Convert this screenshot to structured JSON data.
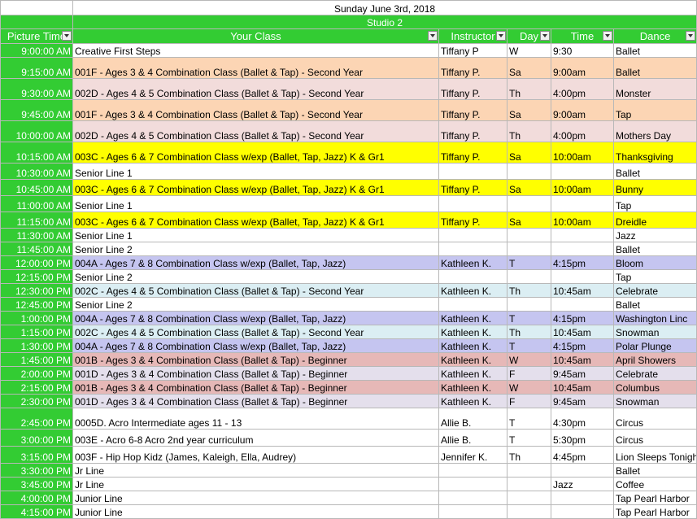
{
  "sheet": {
    "title": "Sunday June 3rd, 2018",
    "studio": "Studio 2",
    "columns": [
      "Picture Time",
      "Your Class",
      "Instructor",
      "Day",
      "Time",
      "Dance"
    ],
    "colors": {
      "header_green": "#33cc33",
      "peach": "#fcd5b4",
      "pink": "#f2dcdb",
      "yellow": "#ffff00",
      "lavender": "#c5c5f0",
      "light_blue": "#dbeef3",
      "rose": "#e6b8b7",
      "light_lavender": "#e4dfec"
    },
    "rows": [
      {
        "time": "9:00:00 AM",
        "class": "Creative First Steps",
        "instructor": "Tiffany P",
        "day": "W",
        "ctime": "9:30",
        "dance": "Ballet",
        "bg": "#ffffff",
        "bold": true,
        "h": 17
      },
      {
        "time": "9:15:00 AM",
        "class": "001F - Ages 3 & 4 Combination Class (Ballet & Tap) - Second Year",
        "instructor": "Tiffany P.",
        "day": "Sa",
        "ctime": "9:00am",
        "dance": "Ballet",
        "bg": "#fcd5b4",
        "bold": false,
        "h": 26
      },
      {
        "time": "9:30:00 AM",
        "class": "002D - Ages 4 & 5 Combination Class (Ballet & Tap) - Second Year",
        "instructor": "Tiffany P.",
        "day": "Th",
        "ctime": "4:00pm",
        "dance": "Monster",
        "bg": "#f2dcdb",
        "bold": false,
        "h": 26
      },
      {
        "time": "9:45:00 AM",
        "class": "001F - Ages 3 & 4 Combination Class (Ballet & Tap) - Second Year",
        "instructor": "Tiffany P.",
        "day": "Sa",
        "ctime": "9:00am",
        "dance": "Tap",
        "bg": "#fcd5b4",
        "bold": false,
        "h": 26
      },
      {
        "time": "10:00:00 AM",
        "class": "002D - Ages 4 & 5 Combination Class (Ballet & Tap) - Second Year",
        "instructor": "Tiffany P.",
        "day": "Th",
        "ctime": "4:00pm",
        "dance": "Mothers Day",
        "bg": "#f2dcdb",
        "bold": false,
        "h": 26
      },
      {
        "time": "10:15:00 AM",
        "class": "003C - Ages 6 & 7 Combination Class w/exp (Ballet, Tap, Jazz) K & Gr1",
        "instructor": "Tiffany P.",
        "day": "Sa",
        "ctime": "10:00am",
        "dance": "Thanksgiving",
        "bg": "#ffff00",
        "bold": false,
        "h": 26
      },
      {
        "time": "10:30:00 AM",
        "class": "Senior Line 1",
        "instructor": "",
        "day": "",
        "ctime": "",
        "dance": "Ballet",
        "bg": "#ffffff",
        "bold": true,
        "h": 20
      },
      {
        "time": "10:45:00 AM",
        "class": "003C - Ages 6 & 7 Combination Class w/exp (Ballet, Tap, Jazz) K & Gr1",
        "instructor": "Tiffany P.",
        "day": "Sa",
        "ctime": "10:00am",
        "dance": "Bunny",
        "bg": "#ffff00",
        "bold": false,
        "h": 20
      },
      {
        "time": "11:00:00 AM",
        "class": "Senior Line 1",
        "instructor": "",
        "day": "",
        "ctime": "",
        "dance": "Tap",
        "bg": "#ffffff",
        "bold": true,
        "h": 20
      },
      {
        "time": "11:15:00 AM",
        "class": "003C - Ages 6 & 7 Combination Class w/exp (Ballet, Tap, Jazz) K & Gr1",
        "instructor": "Tiffany P.",
        "day": "Sa",
        "ctime": "10:00am",
        "dance": "Dreidle",
        "bg": "#ffff00",
        "bold": false,
        "h": 20
      },
      {
        "time": "11:30:00 AM",
        "class": "Senior Line 1",
        "instructor": "",
        "day": "",
        "ctime": "",
        "dance": "Jazz",
        "bg": "#ffffff",
        "bold": true,
        "h": 17
      },
      {
        "time": "11:45:00 AM",
        "class": "Senior Line 2",
        "instructor": "",
        "day": "",
        "ctime": "",
        "dance": "Ballet",
        "bg": "#ffffff",
        "bold": false,
        "h": 17
      },
      {
        "time": "12:00:00 PM",
        "class": "004A - Ages 7 & 8 Combination Class w/exp (Ballet, Tap, Jazz)",
        "instructor": "Kathleen K.",
        "day": "T",
        "ctime": "4:15pm",
        "dance": "Bloom",
        "bg": "#c5c5f0",
        "bold": false,
        "h": 17
      },
      {
        "time": "12:15:00 PM",
        "class": "Senior Line 2",
        "instructor": "",
        "day": "",
        "ctime": "",
        "dance": "Tap",
        "bg": "#ffffff",
        "bold": true,
        "h": 17
      },
      {
        "time": "12:30:00 PM",
        "class": "002C - Ages 4 & 5 Combination Class (Ballet & Tap) - Second Year",
        "instructor": "Kathleen K.",
        "day": "Th",
        "ctime": "10:45am",
        "dance": "Celebrate",
        "bg": "#dbeef3",
        "bold": false,
        "h": 17
      },
      {
        "time": "12:45:00 PM",
        "class": "Senior Line 2",
        "instructor": "",
        "day": "",
        "ctime": "",
        "dance": "Ballet",
        "bg": "#ffffff",
        "bold": false,
        "h": 17
      },
      {
        "time": "1:00:00 PM",
        "class": "004A - Ages 7 & 8 Combination Class w/exp (Ballet, Tap, Jazz)",
        "instructor": "Kathleen K.",
        "day": "T",
        "ctime": "4:15pm",
        "dance": "Washington Linc",
        "bg": "#c5c5f0",
        "bold": false,
        "h": 17
      },
      {
        "time": "1:15:00 PM",
        "class": "002C - Ages 4 & 5 Combination Class (Ballet & Tap) - Second Year",
        "instructor": "Kathleen K.",
        "day": "Th",
        "ctime": "10:45am",
        "dance": "Snowman",
        "bg": "#dbeef3",
        "bold": false,
        "h": 17
      },
      {
        "time": "1:30:00 PM",
        "class": "004A - Ages 7 & 8 Combination Class w/exp (Ballet, Tap, Jazz)",
        "instructor": "Kathleen K.",
        "day": "T",
        "ctime": "4:15pm",
        "dance": "Polar Plunge",
        "bg": "#c5c5f0",
        "bold": false,
        "h": 17
      },
      {
        "time": "1:45:00 PM",
        "class": "001B - Ages 3 & 4 Combination Class (Ballet & Tap) - Beginner",
        "instructor": "Kathleen K.",
        "day": "W",
        "ctime": "10:45am",
        "dance": "April Showers",
        "bg": "#e6b8b7",
        "bold": false,
        "h": 17
      },
      {
        "time": "2:00:00 PM",
        "class": "001D - Ages 3 & 4 Combination Class (Ballet & Tap) - Beginner",
        "instructor": "Kathleen K.",
        "day": "F",
        "ctime": "9:45am",
        "dance": "Celebrate",
        "bg": "#e4dfec",
        "bold": false,
        "h": 17
      },
      {
        "time": "2:15:00 PM",
        "class": "001B - Ages 3 & 4 Combination Class (Ballet & Tap) - Beginner",
        "instructor": "Kathleen K.",
        "day": "W",
        "ctime": "10:45am",
        "dance": "Columbus",
        "bg": "#e6b8b7",
        "bold": false,
        "h": 17
      },
      {
        "time": "2:30:00 PM",
        "class": "001D - Ages 3 & 4 Combination Class (Ballet & Tap) - Beginner",
        "instructor": "Kathleen K.",
        "day": "F",
        "ctime": "9:45am",
        "dance": "Snowman",
        "bg": "#e4dfec",
        "bold": false,
        "h": 17
      },
      {
        "time": "2:45:00 PM",
        "class": "0005D. Acro Intermediate ages 11 - 13",
        "instructor": "Allie B.",
        "day": "T",
        "ctime": "4:30pm",
        "dance": "Circus",
        "bg": "#ffffff",
        "bold": true,
        "h": 26
      },
      {
        "time": "3:00:00 PM",
        "class": "003E - Acro 6-8 Acro 2nd year curriculum",
        "instructor": "Allie B.",
        "day": "T",
        "ctime": "5:30pm",
        "dance": "Circus",
        "bg": "#ffffff",
        "bold": true,
        "h": 21
      },
      {
        "time": "3:15:00 PM",
        "class": "003F - Hip Hop Kidz (James, Kaleigh, Ella, Audrey)",
        "instructor": "Jennifer K.",
        "day": "Th",
        "ctime": "4:45pm",
        "dance": "Lion Sleeps Tonight",
        "bg": "#ffffff",
        "bold": true,
        "h": 21
      },
      {
        "time": "3:30:00 PM",
        "class": "Jr Line",
        "instructor": "",
        "day": "",
        "ctime": "",
        "dance": "Ballet",
        "bg": "#ffffff",
        "bold": true,
        "h": 17
      },
      {
        "time": "3:45:00 PM",
        "class": "Jr Line",
        "instructor": "",
        "day": "",
        "ctime": "Jazz",
        "dance": "Coffee",
        "bg": "#ffffff",
        "bold": true,
        "h": 17
      },
      {
        "time": "4:00:00 PM",
        "class": "Junior Line",
        "instructor": "",
        "day": "",
        "ctime": "",
        "dance": "Tap Pearl Harbor",
        "bg": "#ffffff",
        "bold": true,
        "h": 17
      },
      {
        "time": "4:15:00 PM",
        "class": "Junior Line",
        "instructor": "",
        "day": "",
        "ctime": "",
        "dance": "Tap Pearl Harbor",
        "bg": "#ffffff",
        "bold": true,
        "h": 17
      }
    ]
  }
}
